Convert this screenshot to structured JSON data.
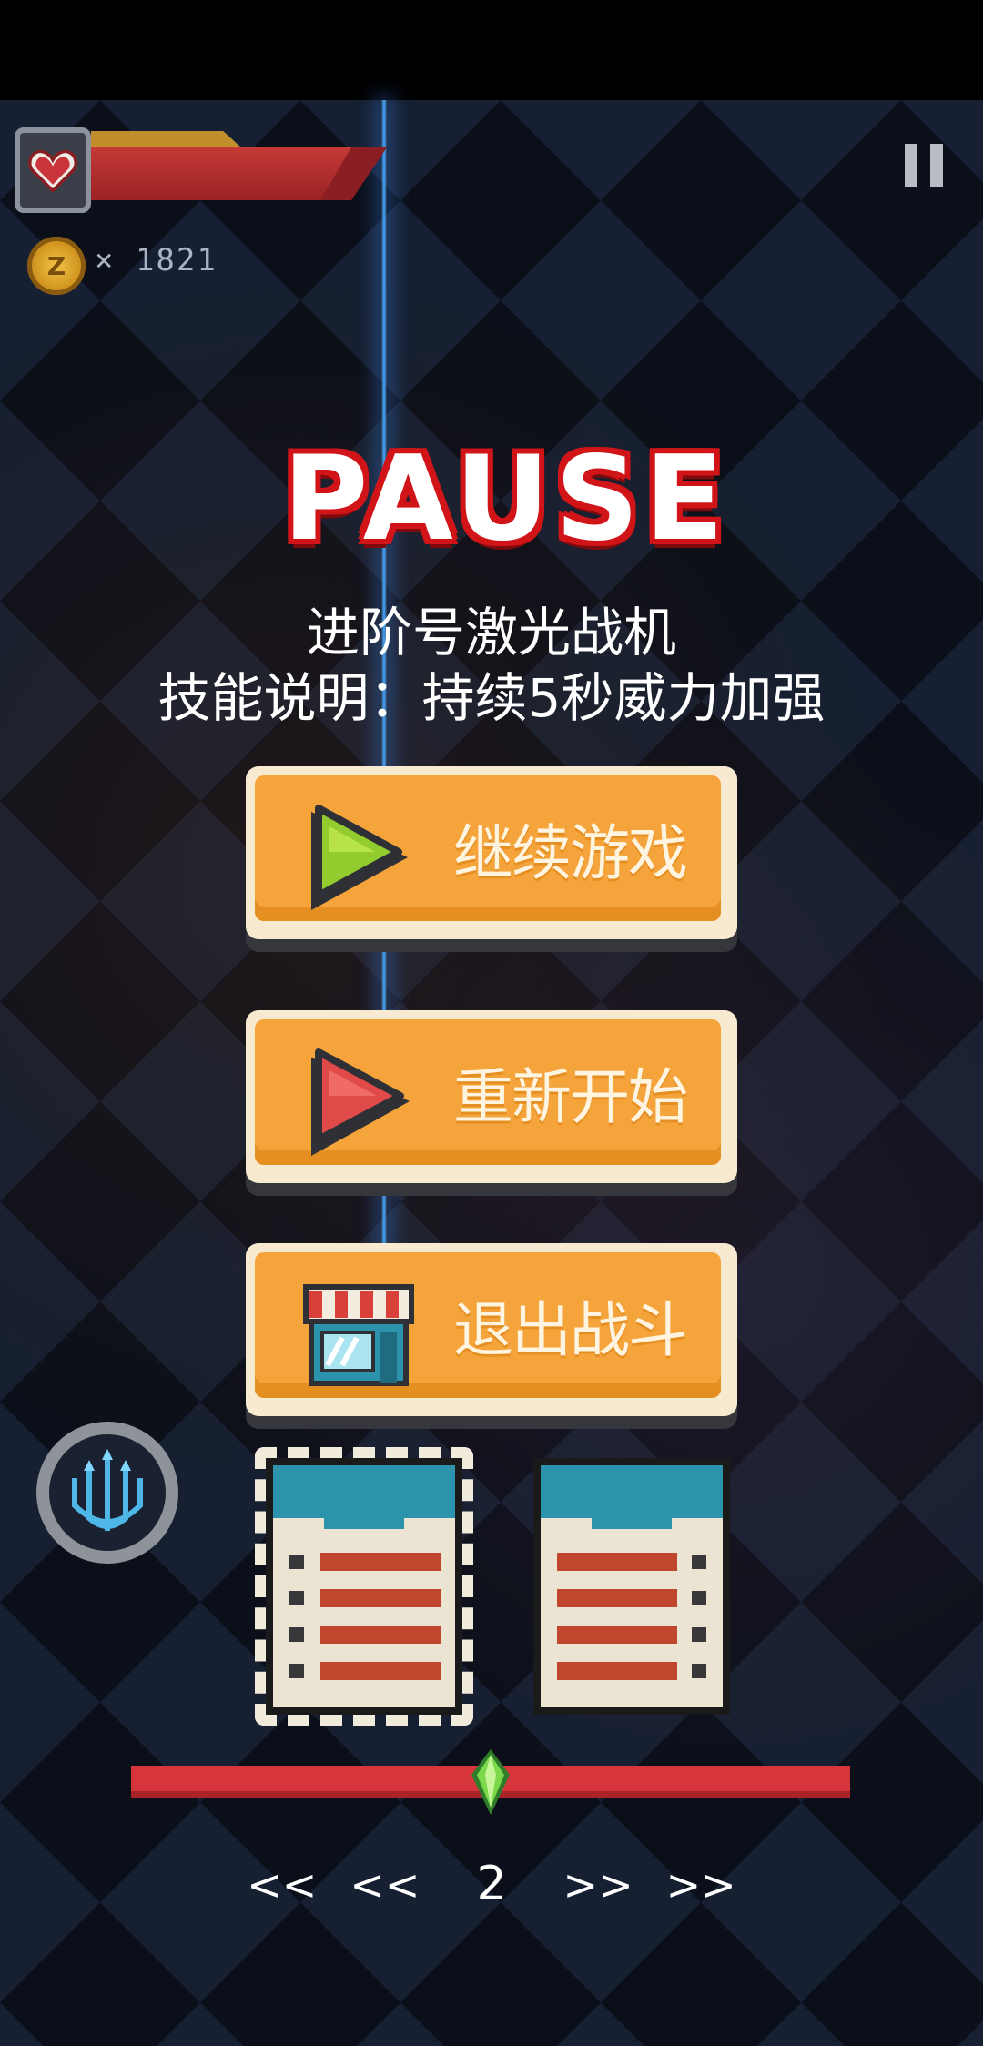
{
  "hud": {
    "coin_text": "× 1821",
    "health_fraction": 0.88
  },
  "title": "PAUSE",
  "weapon": {
    "name": "进阶号激光战机",
    "skill": "技能说明：持续5秒威力加强"
  },
  "menu": {
    "continue_label": "继续游戏",
    "restart_label": "重新开始",
    "exit_label": "退出战斗"
  },
  "pager": {
    "prev_prev": "<<",
    "prev": "<<",
    "page": "2",
    "next": ">>",
    "next_next": ">>"
  },
  "slider": {
    "level": 0.5
  },
  "colors": {
    "button_orange": "#f5a43b",
    "title_red": "#d01418",
    "health_red": "#9c2225",
    "slider_red": "#d6353b",
    "gem_green": "#7ad84a"
  }
}
